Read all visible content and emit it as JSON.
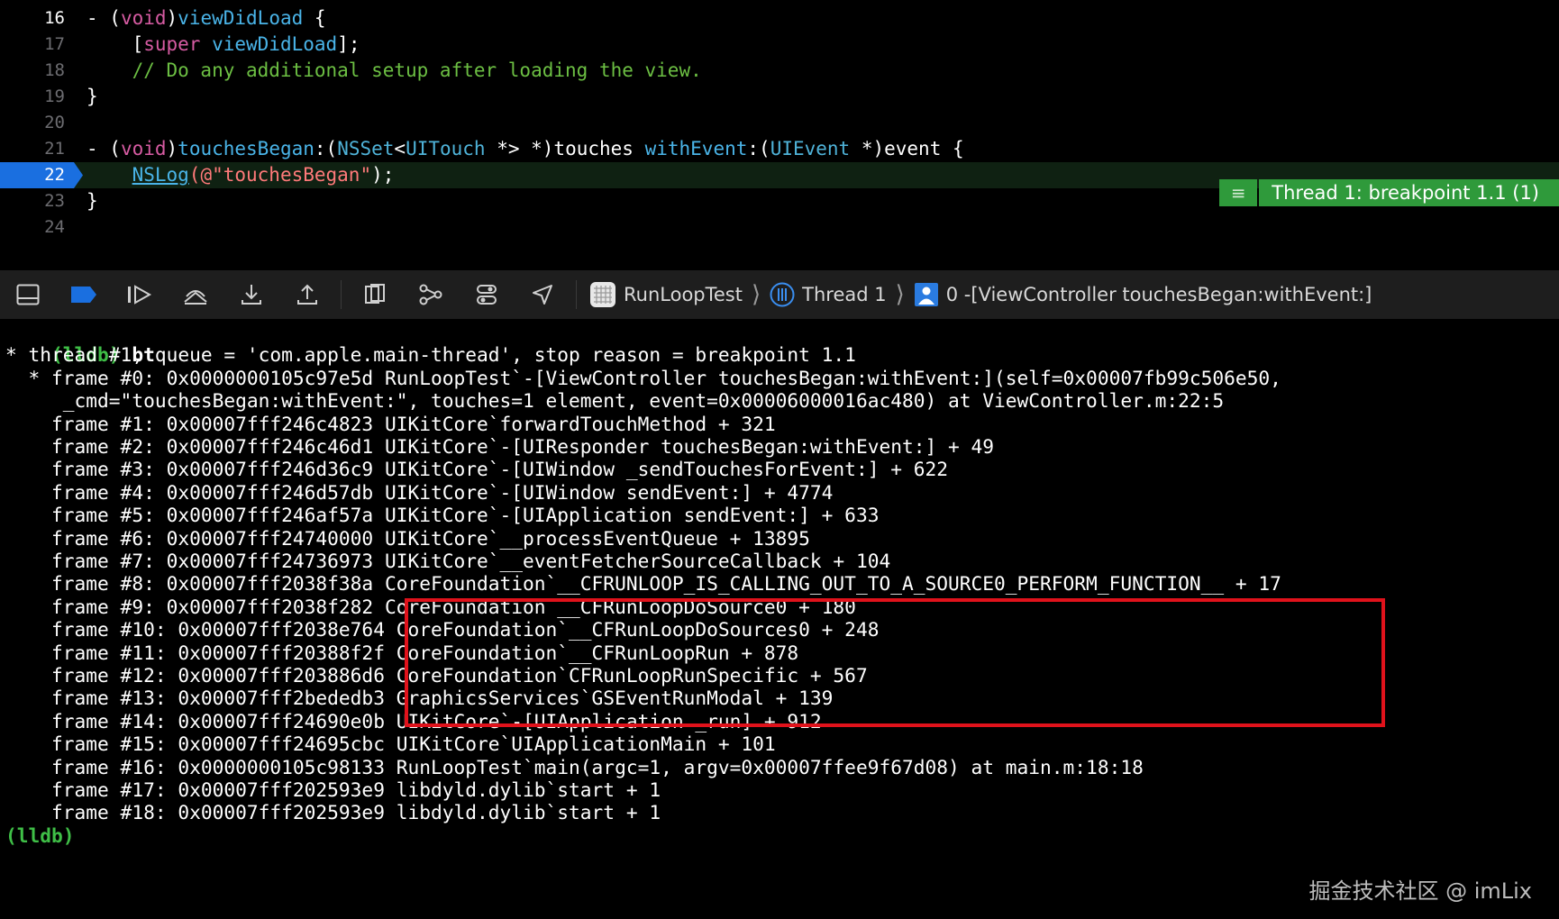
{
  "editor": {
    "lines": [
      {
        "num": "16",
        "segments": [
          [
            "pl",
            "- ("
          ],
          [
            "kw",
            "void"
          ],
          [
            "pl",
            ")"
          ],
          [
            "fn",
            "viewDidLoad"
          ],
          [
            "pl",
            " {"
          ]
        ]
      },
      {
        "num": "17",
        "segments": [
          [
            "pl",
            "    ["
          ],
          [
            "kw",
            "super"
          ],
          [
            "pl",
            " "
          ],
          [
            "fn",
            "viewDidLoad"
          ],
          [
            "pl",
            "];"
          ]
        ]
      },
      {
        "num": "18",
        "segments": [
          [
            "cm",
            "    // Do any additional setup after loading the view."
          ]
        ]
      },
      {
        "num": "19",
        "segments": [
          [
            "pl",
            "}"
          ]
        ]
      },
      {
        "num": "20",
        "segments": []
      },
      {
        "num": "21",
        "segments": [
          [
            "pl",
            "- ("
          ],
          [
            "kw",
            "void"
          ],
          [
            "pl",
            ")"
          ],
          [
            "fn",
            "touchesBegan"
          ],
          [
            "pl",
            ":("
          ],
          [
            "ty",
            "NSSet"
          ],
          [
            "pl",
            "<"
          ],
          [
            "ty",
            "UITouch"
          ],
          [
            "pl",
            " *> *)touches "
          ],
          [
            "fn",
            "withEvent"
          ],
          [
            "pl",
            ":("
          ],
          [
            "ty",
            "UIEvent"
          ],
          [
            "pl",
            " *)event {"
          ]
        ]
      },
      {
        "num": "22",
        "segments": [
          [
            "pl",
            "    "
          ],
          [
            "ul",
            "NSLog"
          ],
          [
            "st",
            "(@\"touchesBegan\""
          ],
          [
            "pl",
            ");"
          ]
        ]
      },
      {
        "num": "23",
        "segments": [
          [
            "pl",
            "}"
          ]
        ]
      },
      {
        "num": "24",
        "segments": []
      }
    ],
    "current_line": "22",
    "breakpoint_label": "Thread 1: breakpoint 1.1 (1)"
  },
  "debugbar": {
    "app": "RunLoopTest",
    "thread": "Thread 1",
    "frame": "0 -[ViewController touchesBegan:withEvent:]"
  },
  "console": {
    "prompt": "(lldb)",
    "command": "bt",
    "lines": [
      "* thread #1, queue = 'com.apple.main-thread', stop reason = breakpoint 1.1",
      "  * frame #0: 0x0000000105c97e5d RunLoopTest`-[ViewController touchesBegan:withEvent:](self=0x00007fb99c506e50,",
      "     _cmd=\"touchesBegan:withEvent:\", touches=1 element, event=0x00006000016ac480) at ViewController.m:22:5",
      "    frame #1: 0x00007fff246c4823 UIKitCore`forwardTouchMethod + 321",
      "    frame #2: 0x00007fff246c46d1 UIKitCore`-[UIResponder touchesBegan:withEvent:] + 49",
      "    frame #3: 0x00007fff246d36c9 UIKitCore`-[UIWindow _sendTouchesForEvent:] + 622",
      "    frame #4: 0x00007fff246d57db UIKitCore`-[UIWindow sendEvent:] + 4774",
      "    frame #5: 0x00007fff246af57a UIKitCore`-[UIApplication sendEvent:] + 633",
      "    frame #6: 0x00007fff24740000 UIKitCore`__processEventQueue + 13895",
      "    frame #7: 0x00007fff24736973 UIKitCore`__eventFetcherSourceCallback + 104",
      "    frame #8: 0x00007fff2038f38a CoreFoundation`__CFRUNLOOP_IS_CALLING_OUT_TO_A_SOURCE0_PERFORM_FUNCTION__ + 17",
      "    frame #9: 0x00007fff2038f282 CoreFoundation`__CFRunLoopDoSource0 + 180",
      "    frame #10: 0x00007fff2038e764 CoreFoundation`__CFRunLoopDoSources0 + 248",
      "    frame #11: 0x00007fff20388f2f CoreFoundation`__CFRunLoopRun + 878",
      "    frame #12: 0x00007fff203886d6 CoreFoundation`CFRunLoopRunSpecific + 567",
      "    frame #13: 0x00007fff2bededb3 GraphicsServices`GSEventRunModal + 139",
      "    frame #14: 0x00007fff24690e0b UIKitCore`-[UIApplication _run] + 912",
      "    frame #15: 0x00007fff24695cbc UIKitCore`UIApplicationMain + 101",
      "    frame #16: 0x0000000105c98133 RunLoopTest`main(argc=1, argv=0x00007ffee9f67d08) at main.m:18:18",
      "    frame #17: 0x00007fff202593e9 libdyld.dylib`start + 1",
      "    frame #18: 0x00007fff202593e9 libdyld.dylib`start + 1"
    ],
    "end_prompt": "(lldb)"
  },
  "colors": {
    "breakpoint": "#1a6fe0",
    "highlight_box": "#e0121b",
    "prompt": "#3fbf47",
    "badge": "#2f9a3b"
  },
  "watermark": "掘金技术社区 @ imLix"
}
